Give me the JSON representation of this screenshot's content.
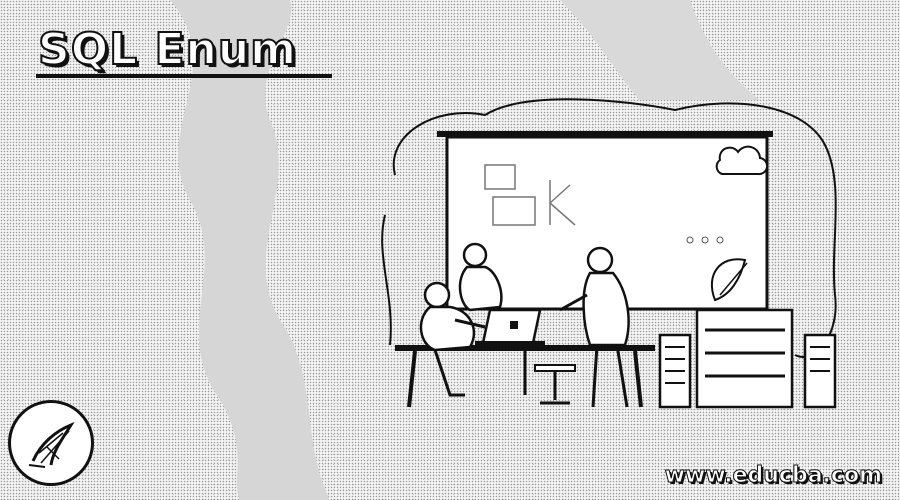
{
  "banner": {
    "title": "SQL Enum",
    "website": "www.educba.com"
  },
  "illustration": {
    "subject": "people-working-at-whiteboard",
    "icons": [
      "cloud-icon",
      "server-rack-icon",
      "laptop-icon",
      "plant-icon"
    ]
  },
  "colors": {
    "ink": "#111111",
    "paper": "#ffffff",
    "stipple": "#9a9a9a"
  }
}
